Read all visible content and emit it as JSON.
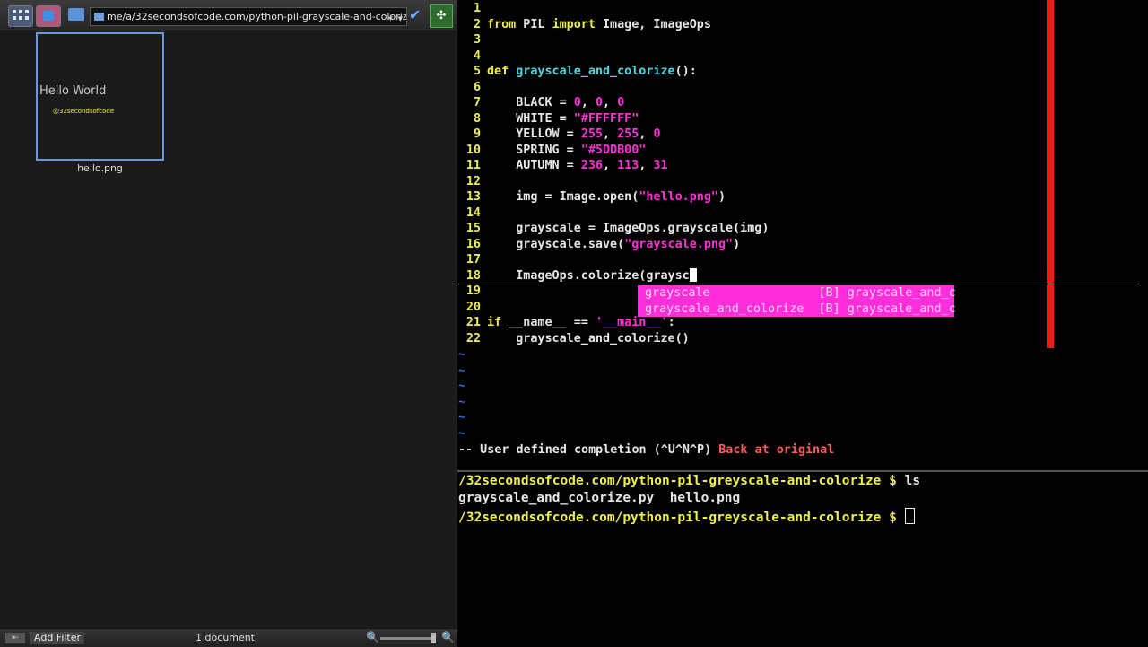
{
  "browser": {
    "path": "me/a/32secondsofcode.com/python-pil-grayscale-and-colorize/",
    "file": {
      "name": "hello.png",
      "thumb_text": "Hello World",
      "thumb_subtext": "@32secondsofcode"
    },
    "status": {
      "add_filter": "Add Filter",
      "document_count": "1 document"
    }
  },
  "editor": {
    "lines": [
      {
        "n": "1",
        "segs": []
      },
      {
        "n": "2",
        "segs": [
          {
            "t": "from",
            "c": "kw"
          },
          {
            "t": " PIL "
          },
          {
            "t": "import",
            "c": "kw"
          },
          {
            "t": " Image, ImageOps"
          }
        ]
      },
      {
        "n": "3",
        "segs": []
      },
      {
        "n": "4",
        "segs": []
      },
      {
        "n": "5",
        "segs": [
          {
            "t": "def",
            "c": "kw"
          },
          {
            "t": " "
          },
          {
            "t": "grayscale_and_colorize",
            "c": "fn"
          },
          {
            "t": "():"
          }
        ]
      },
      {
        "n": "6",
        "segs": []
      },
      {
        "n": "7",
        "segs": [
          {
            "t": "    BLACK = "
          },
          {
            "t": "0",
            "c": "num"
          },
          {
            "t": ", "
          },
          {
            "t": "0",
            "c": "num"
          },
          {
            "t": ", "
          },
          {
            "t": "0",
            "c": "num"
          }
        ]
      },
      {
        "n": "8",
        "segs": [
          {
            "t": "    WHITE = "
          },
          {
            "t": "\"#FFFFFF\"",
            "c": "str"
          }
        ]
      },
      {
        "n": "9",
        "segs": [
          {
            "t": "    YELLOW = "
          },
          {
            "t": "255",
            "c": "num"
          },
          {
            "t": ", "
          },
          {
            "t": "255",
            "c": "num"
          },
          {
            "t": ", "
          },
          {
            "t": "0",
            "c": "num"
          }
        ]
      },
      {
        "n": "10",
        "segs": [
          {
            "t": "    SPRING = "
          },
          {
            "t": "\"#5DDB00\"",
            "c": "str"
          }
        ]
      },
      {
        "n": "11",
        "segs": [
          {
            "t": "    AUTUMN = "
          },
          {
            "t": "236",
            "c": "num"
          },
          {
            "t": ", "
          },
          {
            "t": "113",
            "c": "num"
          },
          {
            "t": ", "
          },
          {
            "t": "31",
            "c": "num"
          }
        ]
      },
      {
        "n": "12",
        "segs": []
      },
      {
        "n": "13",
        "segs": [
          {
            "t": "    img = Image.open("
          },
          {
            "t": "\"hello.png\"",
            "c": "str"
          },
          {
            "t": ")"
          }
        ]
      },
      {
        "n": "14",
        "segs": []
      },
      {
        "n": "15",
        "segs": [
          {
            "t": "    grayscale = ImageOps.grayscale(img)"
          }
        ]
      },
      {
        "n": "16",
        "segs": [
          {
            "t": "    grayscale.save("
          },
          {
            "t": "\"grayscale.png\"",
            "c": "str"
          },
          {
            "t": ")"
          }
        ]
      },
      {
        "n": "17",
        "segs": []
      },
      {
        "n": "18",
        "segs": [
          {
            "t": "    ImageOps.colorize(graysc"
          }
        ],
        "cursor": true
      },
      {
        "n": "19",
        "segs": []
      },
      {
        "n": "20",
        "segs": []
      },
      {
        "n": "21",
        "segs": [
          {
            "t": "if",
            "c": "kw"
          },
          {
            "t": " __name__ == "
          },
          {
            "t": "'__main__'",
            "c": "str"
          },
          {
            "t": ":"
          }
        ]
      },
      {
        "n": "22",
        "segs": [
          {
            "t": "    grayscale_and_colorize()"
          }
        ]
      }
    ],
    "completion": [
      "grayscale               [B] grayscale_and_c",
      "grayscale_and_colorize  [B] grayscale_and_c"
    ],
    "tilde": "~",
    "status_msg": "-- User defined completion (^U^N^P) ",
    "status_warn": "Back at original"
  },
  "terminal": {
    "prompt": "/32secondsofcode.com/python-pil-greyscale-and-colorize $ ",
    "command": "ls",
    "output": "grayscale_and_colorize.py  hello.png"
  }
}
